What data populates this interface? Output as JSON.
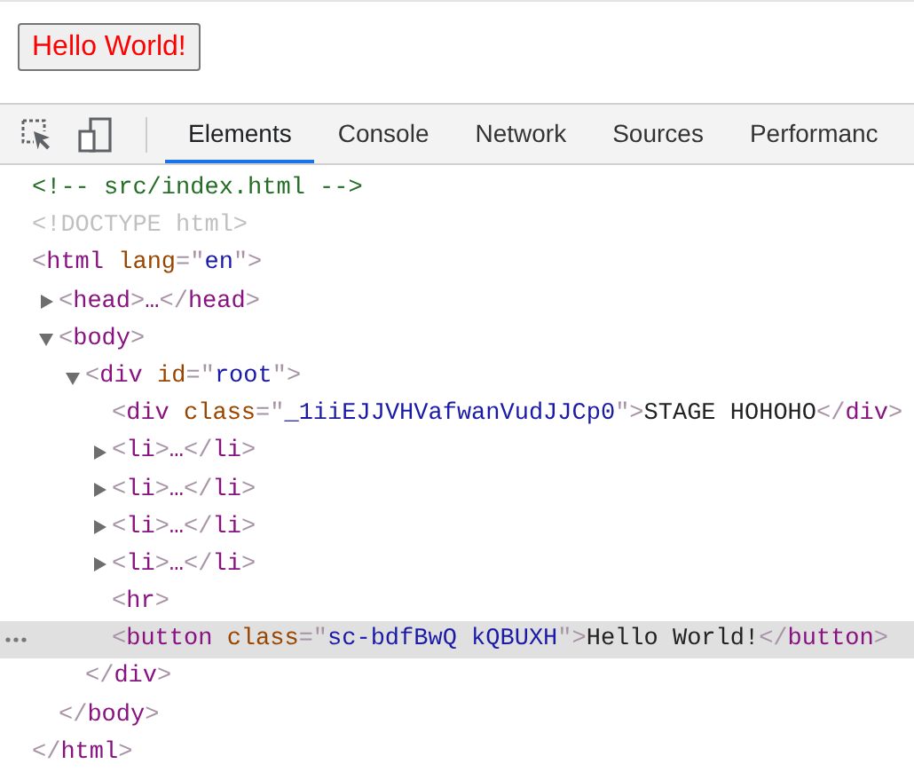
{
  "page": {
    "button": "Hello World!"
  },
  "toolbar": {
    "tabs": [
      {
        "label": "Elements",
        "selected": true
      },
      {
        "label": "Console",
        "selected": false
      },
      {
        "label": "Network",
        "selected": false
      },
      {
        "label": "Sources",
        "selected": false
      },
      {
        "label": "Performanc",
        "selected": false
      }
    ]
  },
  "dom": [
    {
      "selected": false,
      "line": [
        {
          "kind": "comment",
          "text": "<!-- src/index.html -->"
        }
      ]
    },
    {
      "selected": false,
      "line": [
        {
          "kind": "doctype",
          "text": "<!DOCTYPE html>"
        }
      ]
    },
    {
      "selected": false,
      "line": [
        {
          "kind": "punct",
          "text": "<"
        },
        {
          "kind": "tag",
          "text": "html"
        },
        {
          "kind": "attr",
          "text": " lang"
        },
        {
          "kind": "punct",
          "text": "=\""
        },
        {
          "kind": "value",
          "text": "en"
        },
        {
          "kind": "punct",
          "text": "\">"
        }
      ],
      "close": [
        {
          "kind": "punct",
          "text": "</"
        },
        {
          "kind": "tag",
          "text": "html"
        },
        {
          "kind": "punct",
          "text": ">"
        }
      ],
      "children": [
        {
          "selected": false,
          "expanded": false,
          "line": [
            {
              "kind": "punct",
              "text": "<"
            },
            {
              "kind": "tag",
              "text": "head"
            },
            {
              "kind": "punct",
              "text": ">"
            },
            {
              "kind": "tag",
              "text": "…"
            },
            {
              "kind": "punct",
              "text": "</"
            },
            {
              "kind": "tag",
              "text": "head"
            },
            {
              "kind": "punct",
              "text": ">"
            }
          ]
        },
        {
          "selected": false,
          "expanded": true,
          "line": [
            {
              "kind": "punct",
              "text": "<"
            },
            {
              "kind": "tag",
              "text": "body"
            },
            {
              "kind": "punct",
              "text": ">"
            }
          ],
          "close": [
            {
              "kind": "punct",
              "text": "</"
            },
            {
              "kind": "tag",
              "text": "body"
            },
            {
              "kind": "punct",
              "text": ">"
            }
          ],
          "children": [
            {
              "selected": false,
              "expanded": true,
              "line": [
                {
                  "kind": "punct",
                  "text": "<"
                },
                {
                  "kind": "tag",
                  "text": "div"
                },
                {
                  "kind": "attr",
                  "text": " id"
                },
                {
                  "kind": "punct",
                  "text": "=\""
                },
                {
                  "kind": "value",
                  "text": "root"
                },
                {
                  "kind": "punct",
                  "text": "\">"
                }
              ],
              "close": [
                {
                  "kind": "punct",
                  "text": "</"
                },
                {
                  "kind": "tag",
                  "text": "div"
                },
                {
                  "kind": "punct",
                  "text": ">"
                }
              ],
              "children": [
                {
                  "selected": false,
                  "line": [
                    {
                      "kind": "punct",
                      "text": "<"
                    },
                    {
                      "kind": "tag",
                      "text": "div"
                    },
                    {
                      "kind": "attr",
                      "text": " class"
                    },
                    {
                      "kind": "punct",
                      "text": "=\""
                    },
                    {
                      "kind": "value",
                      "text": "_1iiEJJVHVafwanVudJJCp0"
                    },
                    {
                      "kind": "punct",
                      "text": "\">"
                    },
                    {
                      "kind": "text",
                      "text": "STAGE HOHOHO"
                    },
                    {
                      "kind": "punct",
                      "text": "</"
                    },
                    {
                      "kind": "tag",
                      "text": "div"
                    },
                    {
                      "kind": "punct",
                      "text": ">"
                    }
                  ]
                },
                {
                  "selected": false,
                  "expanded": false,
                  "line": [
                    {
                      "kind": "punct",
                      "text": "<"
                    },
                    {
                      "kind": "tag",
                      "text": "li"
                    },
                    {
                      "kind": "punct",
                      "text": ">"
                    },
                    {
                      "kind": "tag",
                      "text": "…"
                    },
                    {
                      "kind": "punct",
                      "text": "</"
                    },
                    {
                      "kind": "tag",
                      "text": "li"
                    },
                    {
                      "kind": "punct",
                      "text": ">"
                    }
                  ]
                },
                {
                  "selected": false,
                  "expanded": false,
                  "line": [
                    {
                      "kind": "punct",
                      "text": "<"
                    },
                    {
                      "kind": "tag",
                      "text": "li"
                    },
                    {
                      "kind": "punct",
                      "text": ">"
                    },
                    {
                      "kind": "tag",
                      "text": "…"
                    },
                    {
                      "kind": "punct",
                      "text": "</"
                    },
                    {
                      "kind": "tag",
                      "text": "li"
                    },
                    {
                      "kind": "punct",
                      "text": ">"
                    }
                  ]
                },
                {
                  "selected": false,
                  "expanded": false,
                  "line": [
                    {
                      "kind": "punct",
                      "text": "<"
                    },
                    {
                      "kind": "tag",
                      "text": "li"
                    },
                    {
                      "kind": "punct",
                      "text": ">"
                    },
                    {
                      "kind": "tag",
                      "text": "…"
                    },
                    {
                      "kind": "punct",
                      "text": "</"
                    },
                    {
                      "kind": "tag",
                      "text": "li"
                    },
                    {
                      "kind": "punct",
                      "text": ">"
                    }
                  ]
                },
                {
                  "selected": false,
                  "expanded": false,
                  "line": [
                    {
                      "kind": "punct",
                      "text": "<"
                    },
                    {
                      "kind": "tag",
                      "text": "li"
                    },
                    {
                      "kind": "punct",
                      "text": ">"
                    },
                    {
                      "kind": "tag",
                      "text": "…"
                    },
                    {
                      "kind": "punct",
                      "text": "</"
                    },
                    {
                      "kind": "tag",
                      "text": "li"
                    },
                    {
                      "kind": "punct",
                      "text": ">"
                    }
                  ]
                },
                {
                  "selected": false,
                  "line": [
                    {
                      "kind": "punct",
                      "text": "<"
                    },
                    {
                      "kind": "tag",
                      "text": "hr"
                    },
                    {
                      "kind": "punct",
                      "text": ">"
                    }
                  ]
                },
                {
                  "selected": true,
                  "line": [
                    {
                      "kind": "punct",
                      "text": "<"
                    },
                    {
                      "kind": "tag",
                      "text": "button"
                    },
                    {
                      "kind": "attr",
                      "text": " class"
                    },
                    {
                      "kind": "punct",
                      "text": "=\""
                    },
                    {
                      "kind": "value",
                      "text": "sc-bdfBwQ kQBUXH"
                    },
                    {
                      "kind": "punct",
                      "text": "\">"
                    },
                    {
                      "kind": "text",
                      "text": "Hello World!"
                    },
                    {
                      "kind": "punct",
                      "text": "</"
                    },
                    {
                      "kind": "tag",
                      "text": "button"
                    },
                    {
                      "kind": "punct",
                      "text": ">"
                    }
                  ]
                }
              ]
            }
          ]
        }
      ]
    }
  ]
}
